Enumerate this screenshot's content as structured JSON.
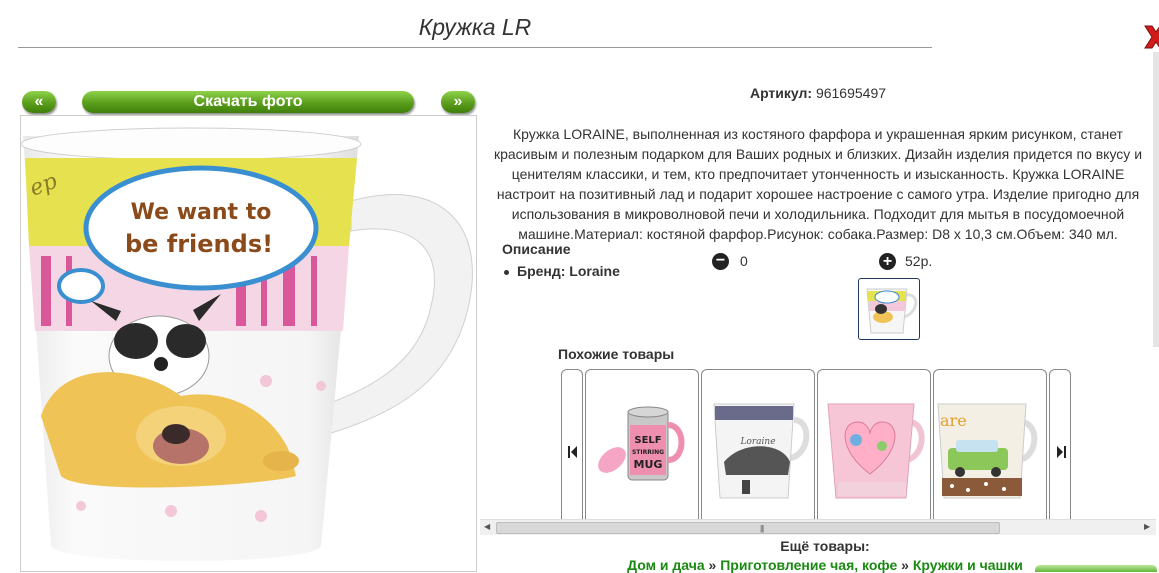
{
  "product": {
    "title": "Кружка LR",
    "sku_label": "Артикул:",
    "sku_value": "961695497",
    "description": "Кружка LORAINE, выполненная из костяного фарфора и украшенная ярким рисунком, станет красивым и полезным подарком для Ваших родных и близких. Дизайн изделия придется по вкусу и ценителям классики, и тем, кто предпочитает утонченность и изысканность. Кружка LORAINE настроит на позитивный лад и подарит хорошее настроение с самого утра. Изделие пригодно для использования в микроволновой печи и холодильника. Подходит для мытья в посудомоечной машине.Материал: костяной фарфор.Рисунок: собака.Размер: D8 x 10,3 см.Объем: 340 мл.",
    "props_title": "Описание",
    "brand_label": "Бренд:",
    "brand_value": "Loraine",
    "quantity": "0",
    "price": "52р.",
    "mug_text_line1": "We want to",
    "mug_text_line2": "be friends!",
    "mug_side_text": "ep"
  },
  "gallery": {
    "prev_label": "«",
    "next_label": "»",
    "download_label": "Скачать фото"
  },
  "similar": {
    "title": "Похожие товары",
    "items": [
      {
        "icon": "self-stirring-mug-image",
        "text_line1": "SELF",
        "text_line2": "STIRRING",
        "text_line3": "MUG"
      },
      {
        "icon": "car-mug-image",
        "text": "Loraine"
      },
      {
        "icon": "heart-mug-image"
      },
      {
        "icon": "retro-car-mug-image",
        "text": "are"
      }
    ]
  },
  "more": {
    "title": "Ещё товары:",
    "crumbs": [
      "Дом и дача",
      "Приготовление чая, кофе",
      "Кружки и чашки"
    ],
    "separator": "»"
  },
  "icons": {
    "close": "close-x-icon",
    "minus": "minus-circle-icon",
    "plus": "plus-circle-icon",
    "carousel_prev": "skip-prev-icon",
    "carousel_next": "skip-next-icon"
  },
  "colors": {
    "button_green": "#5a9e1c",
    "link_green": "#1a8a12",
    "close_red": "#d21b1b"
  }
}
